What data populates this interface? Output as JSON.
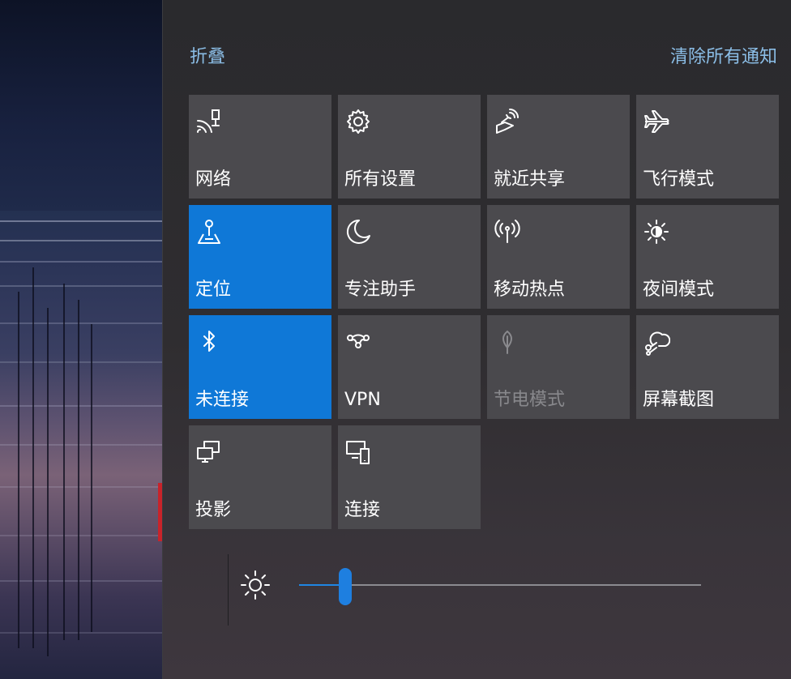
{
  "header": {
    "collapse_label": "折叠",
    "clear_all_label": "清除所有通知"
  },
  "tiles": [
    {
      "id": "network",
      "label": "网络",
      "icon": "network-icon",
      "state": "off"
    },
    {
      "id": "all-settings",
      "label": "所有设置",
      "icon": "gear-icon",
      "state": "off"
    },
    {
      "id": "nearby-sharing",
      "label": "就近共享",
      "icon": "nearby-share-icon",
      "state": "off"
    },
    {
      "id": "airplane-mode",
      "label": "飞行模式",
      "icon": "airplane-icon",
      "state": "off"
    },
    {
      "id": "location",
      "label": "定位",
      "icon": "location-icon",
      "state": "on"
    },
    {
      "id": "focus-assist",
      "label": "专注助手",
      "icon": "moon-icon",
      "state": "off"
    },
    {
      "id": "mobile-hotspot",
      "label": "移动热点",
      "icon": "hotspot-icon",
      "state": "off"
    },
    {
      "id": "night-light",
      "label": "夜间模式",
      "icon": "night-light-icon",
      "state": "off"
    },
    {
      "id": "bluetooth",
      "label": "未连接",
      "icon": "bluetooth-icon",
      "state": "on"
    },
    {
      "id": "vpn",
      "label": "VPN",
      "icon": "vpn-icon",
      "state": "off"
    },
    {
      "id": "battery-saver",
      "label": "节电模式",
      "icon": "leaf-icon",
      "state": "disabled"
    },
    {
      "id": "screen-snip",
      "label": "屏幕截图",
      "icon": "snip-icon",
      "state": "off"
    },
    {
      "id": "project",
      "label": "投影",
      "icon": "project-icon",
      "state": "off"
    },
    {
      "id": "connect",
      "label": "连接",
      "icon": "connect-icon",
      "state": "off"
    }
  ],
  "brightness": {
    "icon": "brightness-icon",
    "level_fraction": 0.115
  },
  "colors": {
    "accent": "#0f78d7",
    "link": "#8bbde6",
    "tile": "#4b4a4e"
  }
}
